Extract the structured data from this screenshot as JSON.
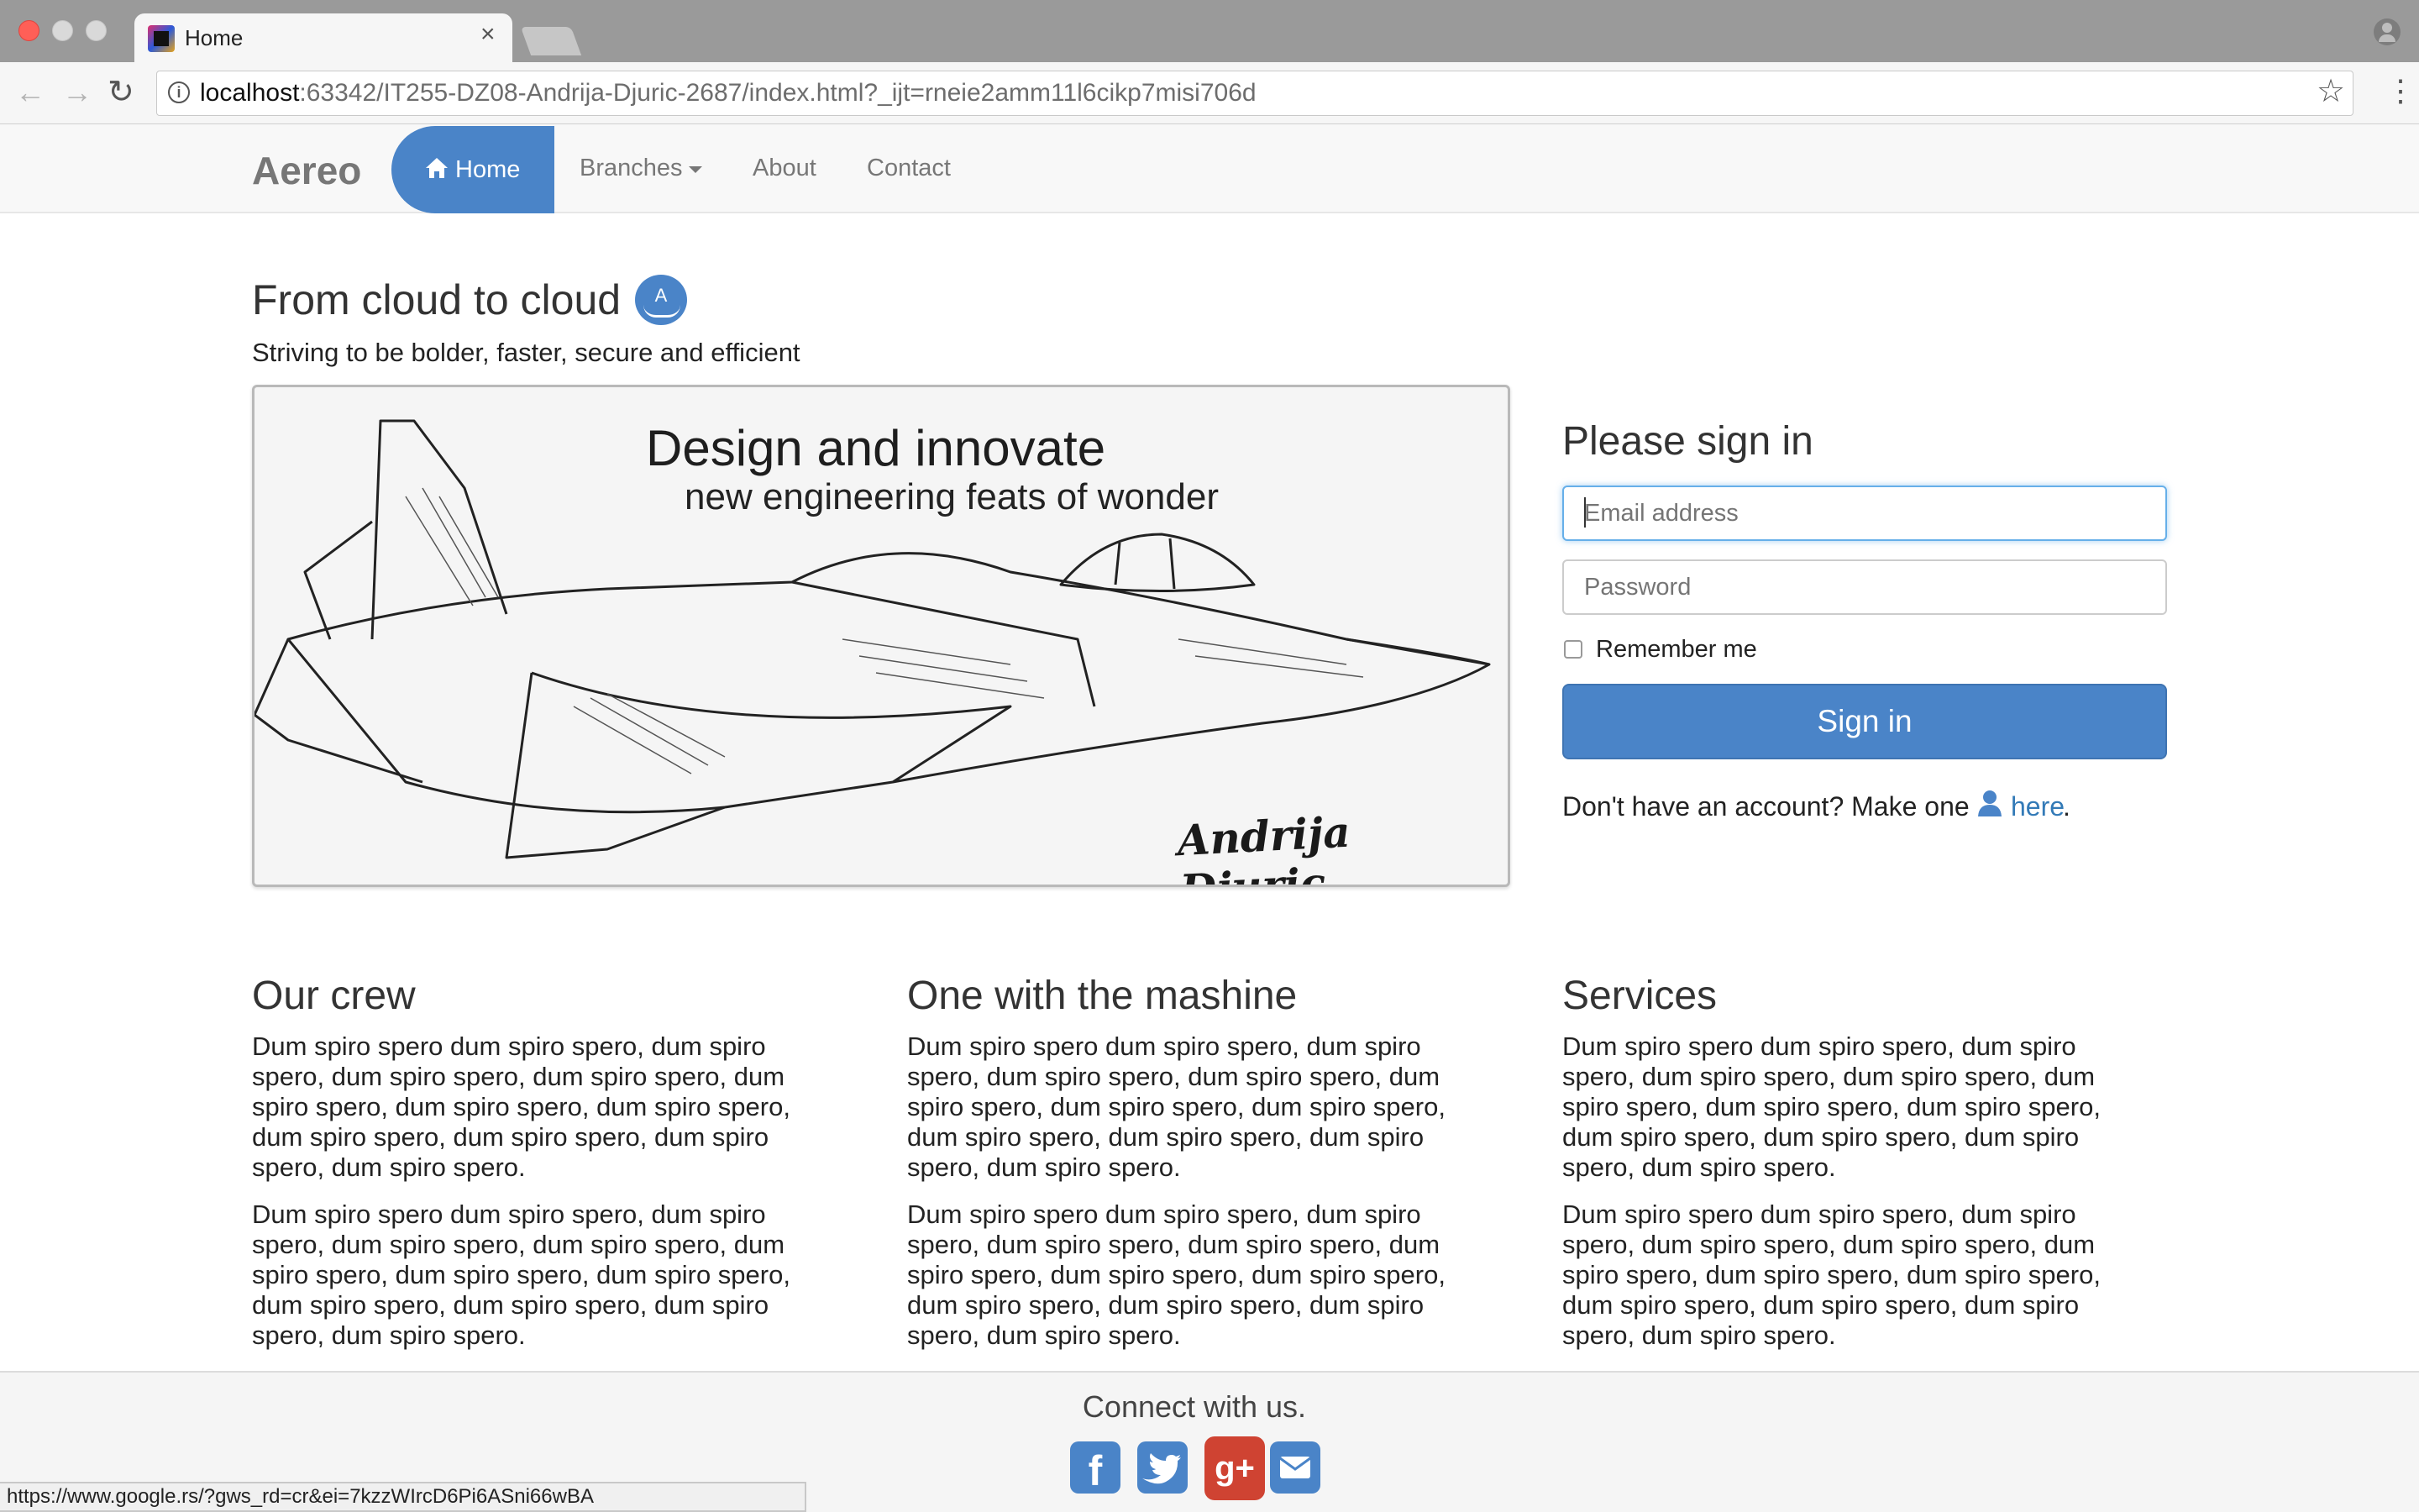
{
  "browser": {
    "tab_title": "Home",
    "tab_close": "×",
    "url_host": "localhost",
    "url_path": ":63342/IT255-DZ08-Andrija-Djuric-2687/index.html?_ijt=rneie2amm11l6cikp7misi706d",
    "status_url": "https://www.google.rs/?gws_rd=cr&ei=7kzzWIrcD6Pi6ASni66wBA",
    "icons": {
      "back": "arrow-left-icon",
      "forward": "arrow-right-icon",
      "reload": "reload-icon",
      "info": "info-icon",
      "star": "star-icon",
      "menu": "kebab-menu-icon",
      "profile": "profile-icon"
    }
  },
  "navbar": {
    "brand": "Aereo",
    "home": "Home",
    "branches": "Branches",
    "about": "About",
    "contact": "Contact",
    "accent_color": "#4a84c8"
  },
  "hero": {
    "title": "From cloud to cloud",
    "logo_letter": "A",
    "subtitle": "Striving to be bolder, faster, secure and efficient"
  },
  "banner": {
    "heading": "Design and innovate",
    "subheading": "new engineering feats of wonder",
    "signature": "Andrija Djuric"
  },
  "signin": {
    "title": "Please sign in",
    "email_placeholder": "Email address",
    "password_placeholder": "Password",
    "remember": "Remember me",
    "button": "Sign in",
    "account_text": "Don't have an account? Make one",
    "link": "here",
    "period": "."
  },
  "columns": [
    {
      "title": "Our crew",
      "paragraphs": [
        "Dum spiro spero dum spiro spero, dum spiro spero, dum spiro spero, dum spiro spero, dum spiro spero, dum spiro spero, dum spiro spero, dum spiro spero, dum spiro spero, dum spiro spero, dum spiro spero.",
        "Dum spiro spero dum spiro spero, dum spiro spero, dum spiro spero, dum spiro spero, dum spiro spero, dum spiro spero, dum spiro spero, dum spiro spero, dum spiro spero, dum spiro spero, dum spiro spero."
      ]
    },
    {
      "title": "One with the mashine",
      "paragraphs": [
        "Dum spiro spero dum spiro spero, dum spiro spero, dum spiro spero, dum spiro spero, dum spiro spero, dum spiro spero, dum spiro spero, dum spiro spero, dum spiro spero, dum spiro spero, dum spiro spero.",
        "Dum spiro spero dum spiro spero, dum spiro spero, dum spiro spero, dum spiro spero, dum spiro spero, dum spiro spero, dum spiro spero, dum spiro spero, dum spiro spero, dum spiro spero, dum spiro spero."
      ]
    },
    {
      "title": "Services",
      "paragraphs": [
        "Dum spiro spero dum spiro spero, dum spiro spero, dum spiro spero, dum spiro spero, dum spiro spero, dum spiro spero, dum spiro spero, dum spiro spero, dum spiro spero, dum spiro spero, dum spiro spero.",
        "Dum spiro spero dum spiro spero, dum spiro spero, dum spiro spero, dum spiro spero, dum spiro spero, dum spiro spero, dum spiro spero, dum spiro spero, dum spiro spero, dum spiro spero, dum spiro spero."
      ]
    }
  ],
  "footer": {
    "connect": "Connect with us.",
    "facebook_glyph": "f",
    "google_glyph": "g+",
    "social_icons": [
      "facebook-icon",
      "twitter-icon",
      "google-plus-icon",
      "email-icon"
    ],
    "google_color": "#cf4332"
  }
}
